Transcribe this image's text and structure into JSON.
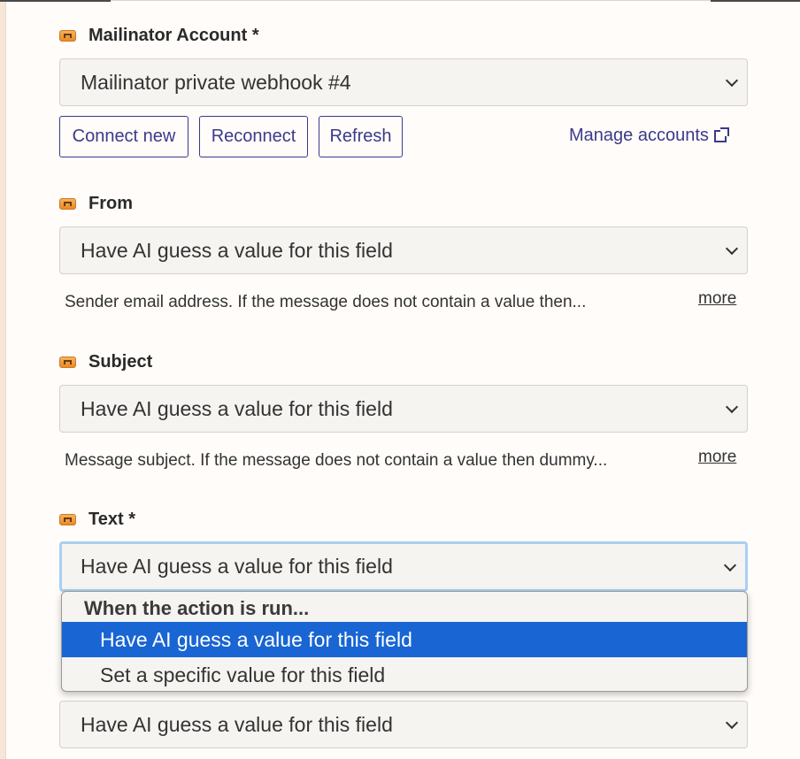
{
  "account": {
    "label": "Mailinator Account *",
    "value": "Mailinator private webhook #4",
    "buttons": {
      "connect_new": "Connect new",
      "reconnect": "Reconnect",
      "refresh": "Refresh"
    },
    "manage_link": "Manage accounts"
  },
  "fields": {
    "from": {
      "label": "From",
      "value": "Have AI guess a value for this field",
      "help": "Sender email address. If the message does not contain a value then...",
      "more": "more"
    },
    "subject": {
      "label": "Subject",
      "value": "Have AI guess a value for this field",
      "help": "Message subject. If the message does not contain a value then dummy...",
      "more": "more"
    },
    "text": {
      "label": "Text *",
      "value": "Have AI guess a value for this field"
    },
    "next": {
      "value": "Have AI guess a value for this field"
    }
  },
  "dropdown": {
    "group": "When the action is run...",
    "options": [
      "Have AI guess a value for this field",
      "Set a specific value for this field"
    ],
    "selected_index": 0,
    "highlight_color": "#1865d3"
  },
  "icons": {
    "app": "mailinator-icon",
    "chevron": "chevron-down-icon",
    "external": "external-link-icon"
  },
  "colors": {
    "accent": "#3b3a8a",
    "focus_ring": "#a9cff3"
  }
}
